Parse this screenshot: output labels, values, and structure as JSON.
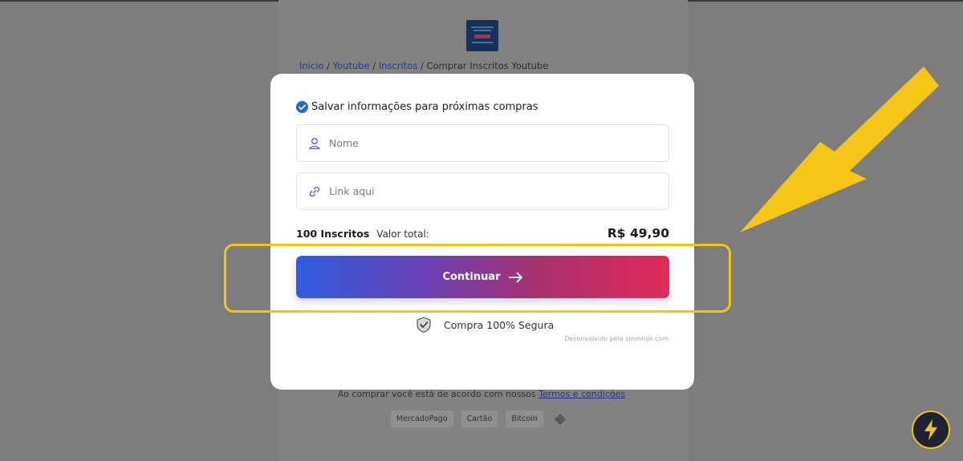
{
  "breadcrumb": {
    "items": [
      "Inicio",
      "Youtube",
      "Inscritos"
    ],
    "separator": "/",
    "current": "Comprar Inscritos Youtube"
  },
  "modal": {
    "save_info_label": "Salvar informações para próximas compras",
    "name_placeholder": "Nome",
    "link_placeholder": "Link aqui",
    "quantity_label": "100 Inscritos",
    "total_label": "Valor total:",
    "price": "R$ 49,90",
    "continue_label": "Continuar",
    "secure_label": "Compra 100% Segura",
    "developer_credit": "Desenvolvido pela smmloja.com"
  },
  "footer": {
    "terms_prefix": "Ao comprar você está de acordo com nossos",
    "terms_link": "Termos e condições",
    "payment_methods": [
      "MercadoPago",
      "Cartão",
      "Bitcoin"
    ]
  },
  "icons": {
    "check": "check-circle-icon",
    "name": "user-icon",
    "link": "link-icon",
    "continue": "arrow-right-icon",
    "secure": "shield-check-icon",
    "floating": "lightning-bolt-icon"
  },
  "colors": {
    "accent_blue": "#2f5ee0",
    "accent_red": "#e2295a",
    "highlight_yellow": "#f4c415",
    "overlay_gray": "#7d7d7d"
  }
}
